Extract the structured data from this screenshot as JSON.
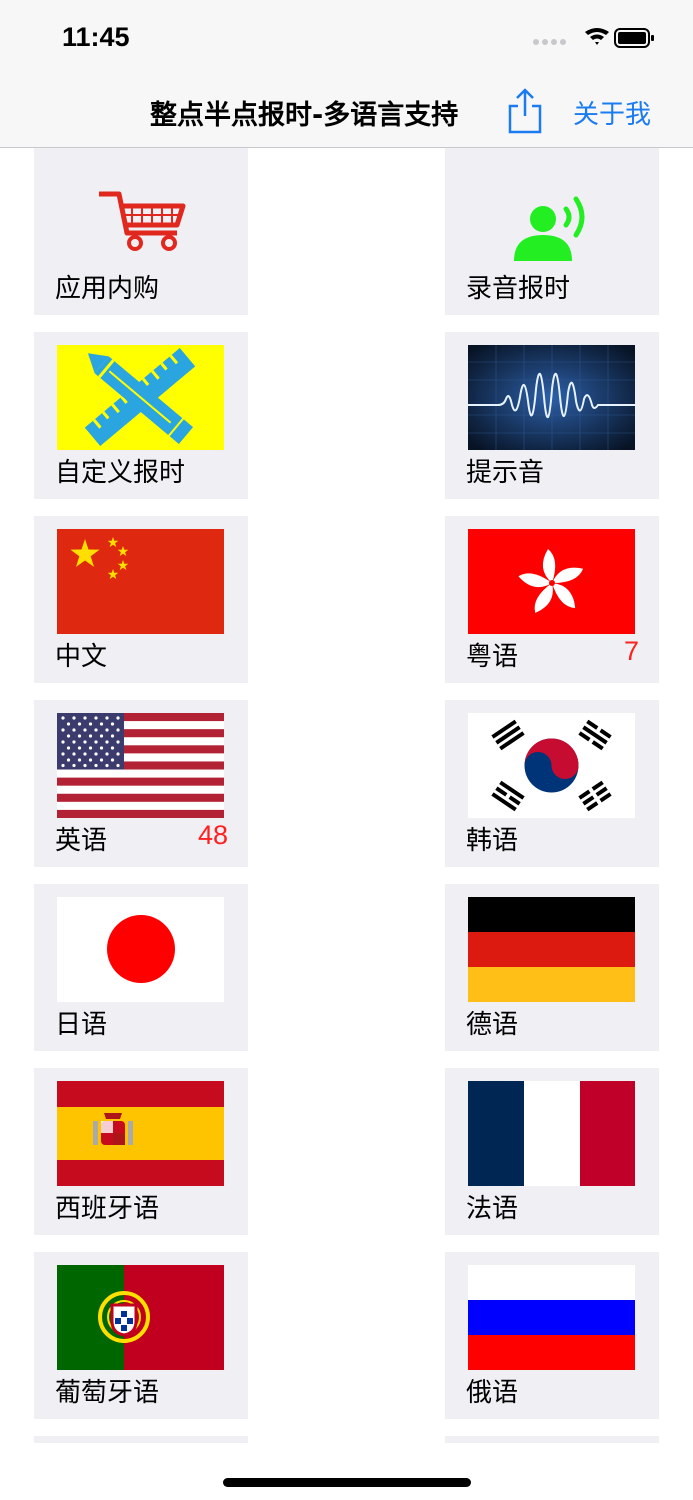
{
  "status_bar": {
    "time": "11:45"
  },
  "nav": {
    "title": "整点半点报时-多语言支持",
    "about_label": "关于我"
  },
  "tiles": [
    {
      "label": "应用内购",
      "count": ""
    },
    {
      "label": "录音报时",
      "count": ""
    },
    {
      "label": "自定义报时",
      "count": ""
    },
    {
      "label": "提示音",
      "count": ""
    },
    {
      "label": "中文",
      "count": ""
    },
    {
      "label": "粤语",
      "count": "7"
    },
    {
      "label": "英语",
      "count": "48"
    },
    {
      "label": "韩语",
      "count": ""
    },
    {
      "label": "日语",
      "count": ""
    },
    {
      "label": "德语",
      "count": ""
    },
    {
      "label": "西班牙语",
      "count": ""
    },
    {
      "label": "法语",
      "count": ""
    },
    {
      "label": "葡萄牙语",
      "count": ""
    },
    {
      "label": "俄语",
      "count": ""
    }
  ],
  "colors": {
    "accent": "#1a7cf0",
    "count_red": "#ff2020",
    "tile_bg": "#efeff4"
  }
}
